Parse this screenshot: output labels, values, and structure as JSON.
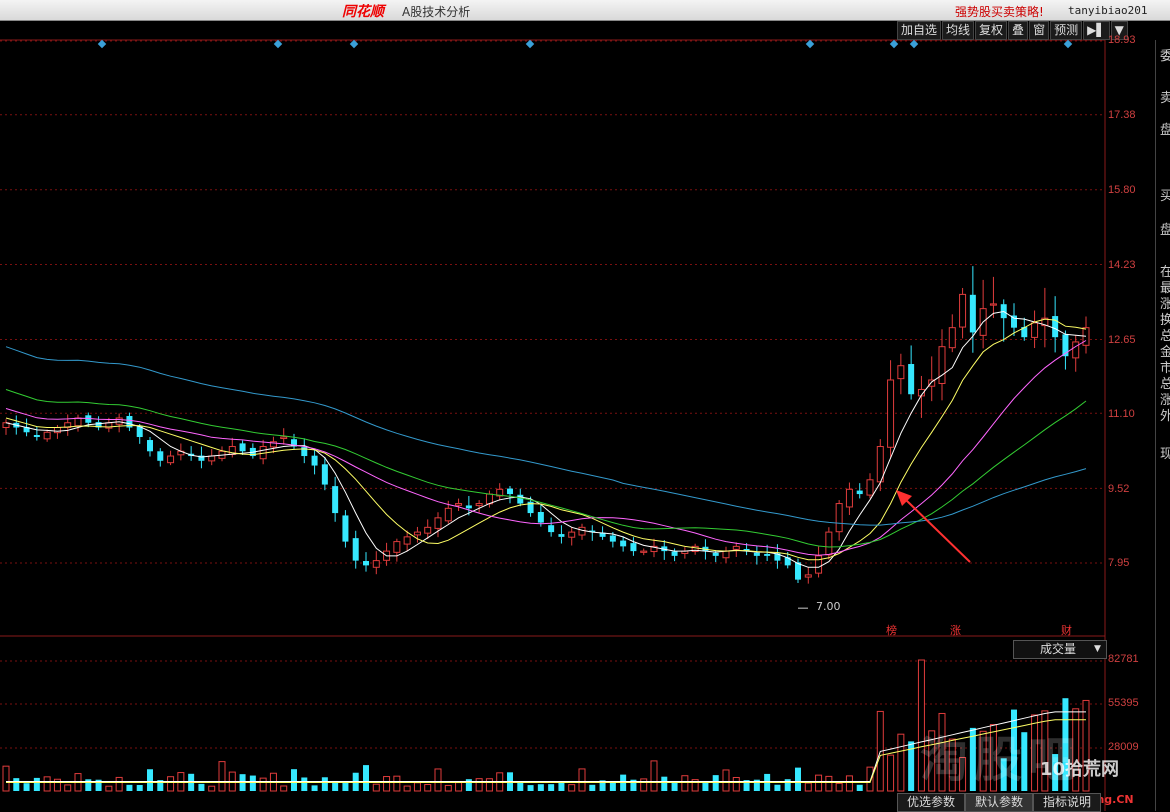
{
  "window": {
    "app_name": "同花顺",
    "title": "A股技术分析",
    "promo": "强势股买卖策略!",
    "username": "tanyibiao201"
  },
  "toolbar": {
    "buttons": [
      "加自选",
      "均线",
      "复权",
      "叠",
      "窗",
      "预测",
      "▶▌",
      "▼"
    ]
  },
  "price_axis": {
    "ticks": [
      "18.93",
      "17.38",
      "15.80",
      "14.23",
      "12.65",
      "11.10",
      "9.52",
      "7.95"
    ]
  },
  "volume_axis": {
    "ticks": [
      "82781",
      "55395",
      "28009"
    ]
  },
  "volume_panel": {
    "indicator_label": "成交量",
    "dropdown_arrow": "▼"
  },
  "annotations": {
    "low_price": "7.00",
    "events": [
      "榜",
      "涨",
      "财"
    ]
  },
  "right_panel": {
    "chars": [
      "委",
      "卖",
      "盘",
      "买",
      "盘",
      "在",
      "最",
      "涨",
      "换",
      "总",
      "金",
      "市",
      "总",
      "涨",
      "外",
      "现"
    ]
  },
  "bottom_tabs": [
    "优选参数",
    "默认参数",
    "指标说明"
  ],
  "watermark": {
    "left": "淘股吧",
    "right": "10拾荒网",
    "right_sub": "Huang.CN"
  },
  "colors": {
    "up": "#e03c3c",
    "down": "#36e8ff",
    "ma5": "#ffffff",
    "ma10": "#ffff66",
    "ma20": "#ff66ff",
    "ma30": "#33cc33",
    "ma60": "#3399cc",
    "grid": "#7a1010",
    "axis_text": "#d04040"
  },
  "chart_data": {
    "type": "candlestick",
    "y_range": [
      7.0,
      18.93
    ],
    "low_marker": 7.0,
    "closes": [
      10.9,
      10.8,
      10.7,
      10.6,
      10.7,
      10.8,
      10.9,
      11.0,
      10.9,
      10.8,
      10.9,
      11.0,
      10.8,
      10.6,
      10.3,
      10.1,
      10.2,
      10.3,
      10.2,
      10.1,
      10.2,
      10.3,
      10.4,
      10.3,
      10.2,
      10.4,
      10.5,
      10.6,
      10.4,
      10.2,
      10.0,
      9.6,
      9.0,
      8.4,
      8.0,
      7.9,
      8.0,
      8.2,
      8.4,
      8.5,
      8.6,
      8.7,
      8.9,
      9.1,
      9.2,
      9.1,
      9.2,
      9.4,
      9.5,
      9.4,
      9.2,
      9.0,
      8.8,
      8.6,
      8.5,
      8.6,
      8.7,
      8.6,
      8.5,
      8.4,
      8.3,
      8.2,
      8.2,
      8.3,
      8.2,
      8.1,
      8.2,
      8.3,
      8.2,
      8.1,
      8.2,
      8.3,
      8.2,
      8.1,
      8.1,
      8.0,
      7.9,
      7.6,
      7.7,
      8.1,
      8.6,
      9.2,
      9.5,
      9.4,
      9.7,
      10.4,
      11.8,
      12.1,
      11.5,
      11.6,
      11.8,
      12.5,
      12.9,
      13.6,
      12.8,
      13.3,
      13.4,
      13.1,
      12.9,
      12.7,
      13.0,
      13.1,
      12.7,
      12.3,
      12.6,
      12.9
    ],
    "volume_range": [
      0,
      82781
    ]
  }
}
